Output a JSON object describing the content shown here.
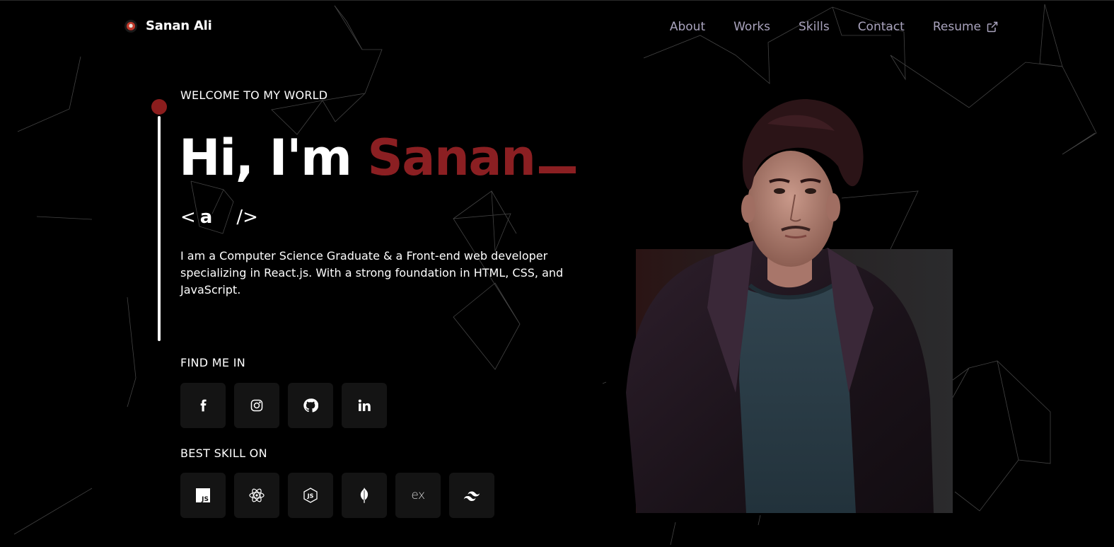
{
  "nav": {
    "brand": "Sanan Ali",
    "links": [
      "About",
      "Works",
      "Skills",
      "Contact"
    ],
    "resume": "Resume"
  },
  "hero": {
    "welcome": "WELCOME TO MY WORLD",
    "greeting": "Hi, I'm",
    "name": "Sanan",
    "tag": {
      "open": "<",
      "typed": "a",
      "close": "/>"
    },
    "intro": "I am a Computer Science Graduate & a Front-end web developer specializing in React.js. With a strong foundation in HTML, CSS, and JavaScript."
  },
  "social": {
    "label": "FIND ME IN",
    "items": [
      {
        "icon": "facebook-icon"
      },
      {
        "icon": "instagram-icon"
      },
      {
        "icon": "github-icon"
      },
      {
        "icon": "linkedin-icon"
      }
    ]
  },
  "skills": {
    "label": "BEST SKILL ON",
    "items": [
      {
        "icon": "javascript-icon"
      },
      {
        "icon": "react-icon"
      },
      {
        "icon": "nodejs-icon"
      },
      {
        "icon": "mongodb-icon"
      },
      {
        "icon": "express-icon",
        "text": "ex"
      },
      {
        "icon": "tailwind-icon"
      }
    ]
  },
  "colors": {
    "accent": "#8b1f22",
    "nav_link": "#a9a3bd",
    "background": "#000000",
    "tile": "#141414"
  }
}
